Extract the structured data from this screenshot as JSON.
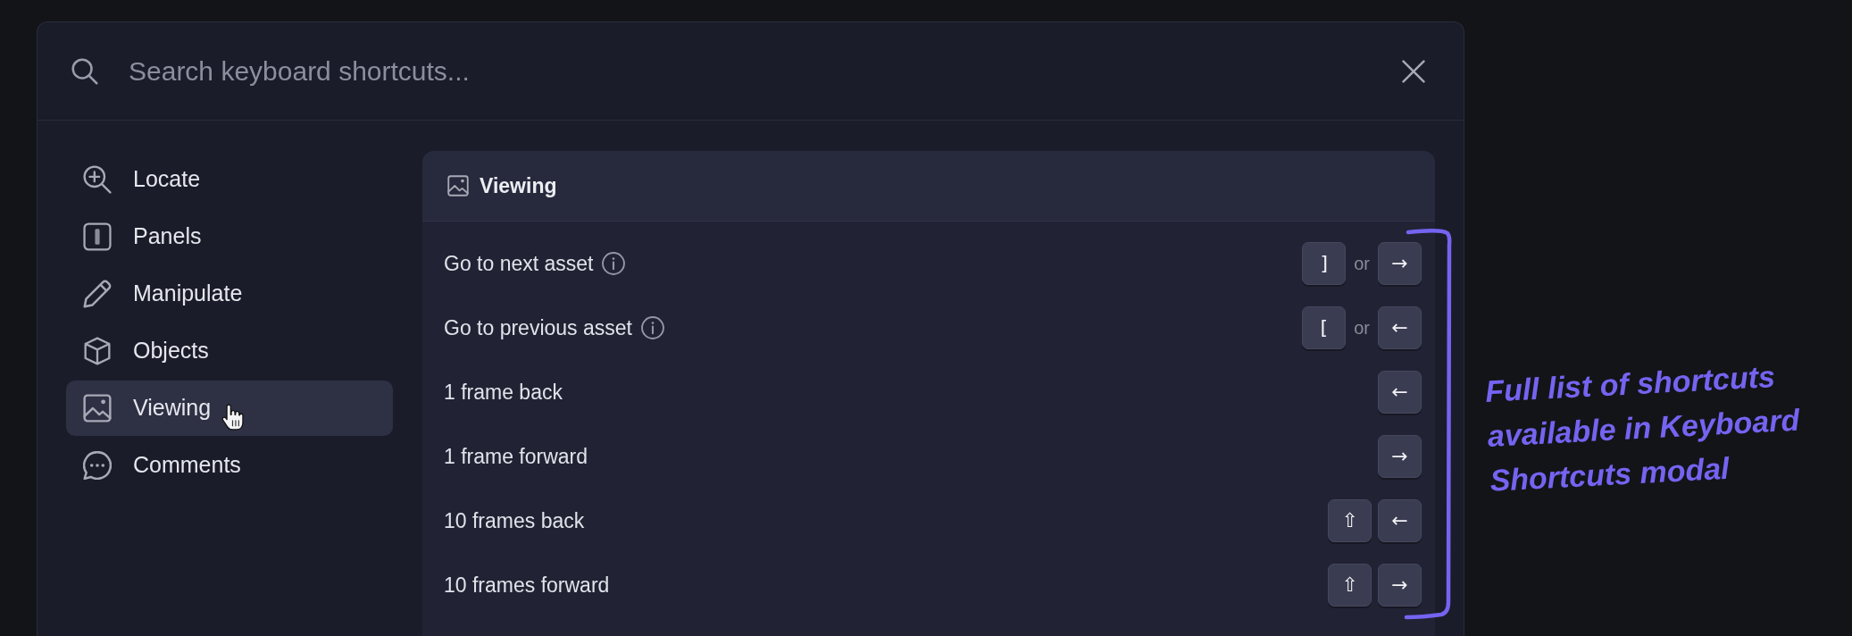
{
  "search": {
    "placeholder": "Search keyboard shortcuts..."
  },
  "sidebar": {
    "items": [
      {
        "label": "Locate",
        "selected": false,
        "hovered": false
      },
      {
        "label": "Panels",
        "selected": false,
        "hovered": false
      },
      {
        "label": "Manipulate",
        "selected": false,
        "hovered": false
      },
      {
        "label": "Objects",
        "selected": false,
        "hovered": false
      },
      {
        "label": "Viewing",
        "selected": true,
        "hovered": true
      },
      {
        "label": "Comments",
        "selected": false,
        "hovered": false
      }
    ]
  },
  "section": {
    "title": "Viewing",
    "rows": [
      {
        "label": "Go to next asset",
        "info": true,
        "keys": [
          {
            "kind": "key",
            "label": "]"
          },
          {
            "kind": "separator",
            "label": "or"
          },
          {
            "kind": "key",
            "label": "→"
          }
        ]
      },
      {
        "label": "Go to previous asset",
        "info": true,
        "keys": [
          {
            "kind": "key",
            "label": "["
          },
          {
            "kind": "separator",
            "label": "or"
          },
          {
            "kind": "key",
            "label": "←"
          }
        ]
      },
      {
        "label": "1 frame back",
        "info": false,
        "keys": [
          {
            "kind": "key",
            "label": "←"
          }
        ]
      },
      {
        "label": "1 frame forward",
        "info": false,
        "keys": [
          {
            "kind": "key",
            "label": "→"
          }
        ]
      },
      {
        "label": "10 frames back",
        "info": false,
        "keys": [
          {
            "kind": "key",
            "label": "⇧"
          },
          {
            "kind": "key",
            "label": "←"
          }
        ]
      },
      {
        "label": "10 frames forward",
        "info": false,
        "keys": [
          {
            "kind": "key",
            "label": "⇧"
          },
          {
            "kind": "key",
            "label": "→"
          }
        ]
      }
    ]
  },
  "annotation": {
    "text": "Full list of shortcuts available in Keyboard Shortcuts modal"
  }
}
